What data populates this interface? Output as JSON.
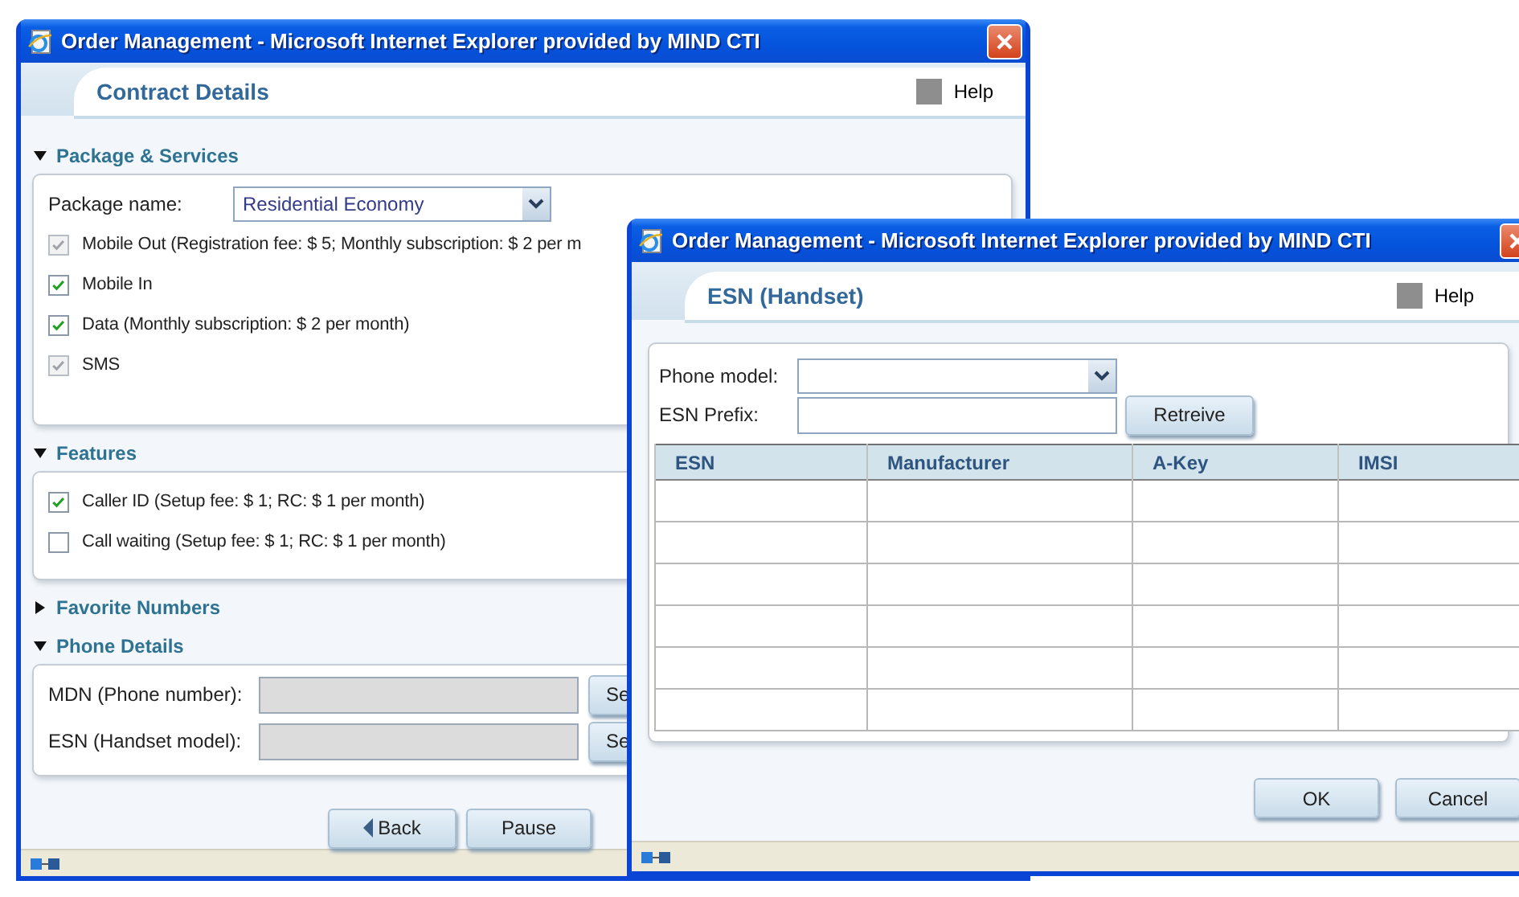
{
  "main_window": {
    "title": "Order Management - Microsoft Internet Explorer provided by MIND CTI",
    "tab": "Contract Details",
    "help": "Help",
    "sections": [
      {
        "kind": "services",
        "title": "Package & Services",
        "expanded": true,
        "package_label": "Package name:",
        "package_value": "Residential Economy",
        "options": [
          {
            "label": "Mobile Out (Registration fee: $ 5; Monthly subscription: $ 2 per m",
            "checked": true,
            "disabled": true
          },
          {
            "label": "Mobile In",
            "checked": true,
            "disabled": false
          },
          {
            "label": "Data (Monthly subscription: $ 2 per month)",
            "checked": true,
            "disabled": false
          },
          {
            "label": "SMS",
            "checked": true,
            "disabled": true
          }
        ]
      },
      {
        "kind": "options",
        "title": "Features",
        "expanded": true,
        "options": [
          {
            "label": "Caller ID (Setup fee: $ 1; RC: $ 1 per month)",
            "checked": true,
            "disabled": false
          },
          {
            "label": "Call waiting (Setup fee: $ 1; RC: $ 1 per month)",
            "checked": false,
            "disabled": false
          }
        ]
      },
      {
        "title": "Favorite Numbers",
        "expanded": false
      },
      {
        "kind": "fields",
        "title": "Phone Details",
        "expanded": true,
        "fields": [
          {
            "label": "MDN (Phone number):",
            "disabled": true,
            "button": "Se"
          },
          {
            "label": "ESN (Handset model):",
            "disabled": true,
            "button": "Se"
          }
        ]
      }
    ],
    "buttons": [
      {
        "kind": "back",
        "label": "Back"
      },
      {
        "kind": "plain",
        "label": "Pause"
      }
    ]
  },
  "dialog": {
    "title": "Order Management - Microsoft Internet Explorer provided by MIND CTI",
    "tab": "ESN (Handset)",
    "help": "Help",
    "fields": [
      {
        "kind": "select",
        "label": "Phone model:"
      },
      {
        "kind": "text",
        "label": "ESN Prefix:",
        "button": "Retreive"
      }
    ],
    "table": {
      "columns": [
        "ESN",
        "Manufacturer",
        "A-Key",
        "IMSI"
      ]
    },
    "buttons": [
      "OK",
      "Cancel"
    ]
  }
}
